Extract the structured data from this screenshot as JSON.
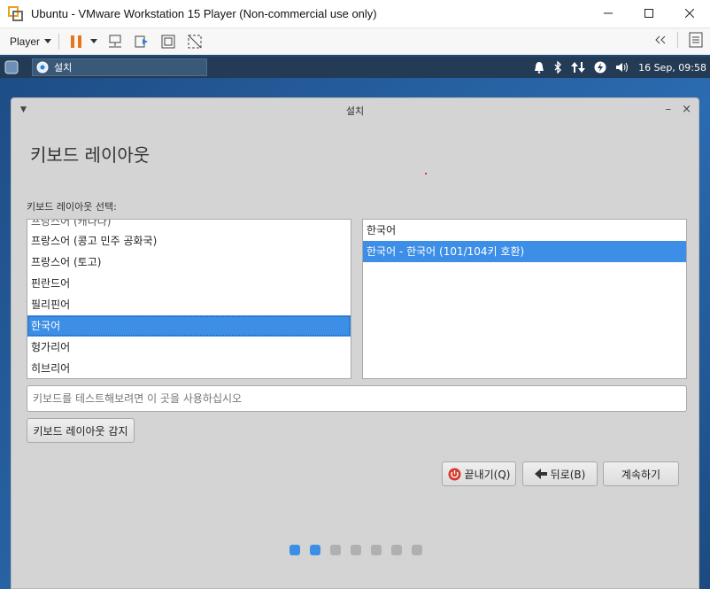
{
  "vm": {
    "title": "Ubuntu - VMware Workstation 15 Player (Non-commercial use only)",
    "player_menu": "Player"
  },
  "panel": {
    "task_label": "설치",
    "clock": "16 Sep, 09:58"
  },
  "installer": {
    "window_title": "설치",
    "page_title": "키보드 레이아웃",
    "select_label": "키보드 레이아웃 선택:",
    "layouts": [
      {
        "label": "프랑스어 (캐나다)",
        "clipped": true
      },
      {
        "label": "프랑스어 (콩고 민주 공화국)"
      },
      {
        "label": "프랑스어 (토고)"
      },
      {
        "label": "핀란드어"
      },
      {
        "label": "필리핀어"
      },
      {
        "label": "한국어",
        "selected": true
      },
      {
        "label": "헝가리어"
      },
      {
        "label": "히브리어"
      }
    ],
    "variants": [
      {
        "label": "한국어"
      },
      {
        "label": "한국어 - 한국어 (101/104키 호환)",
        "selected": true
      }
    ],
    "test_placeholder": "키보드를 테스트해보려면 이 곳을 사용하십시오",
    "detect_button": "키보드 레이아웃 감지",
    "quit_button": "끝내기(Q)",
    "back_button": "뒤로(B)",
    "continue_button": "계속하기",
    "progress": {
      "total_steps": 7,
      "current_step": 2
    }
  },
  "colors": {
    "accent": "#3d8ee6",
    "panel": "#243b55",
    "window_bg": "#d4d4d4"
  }
}
